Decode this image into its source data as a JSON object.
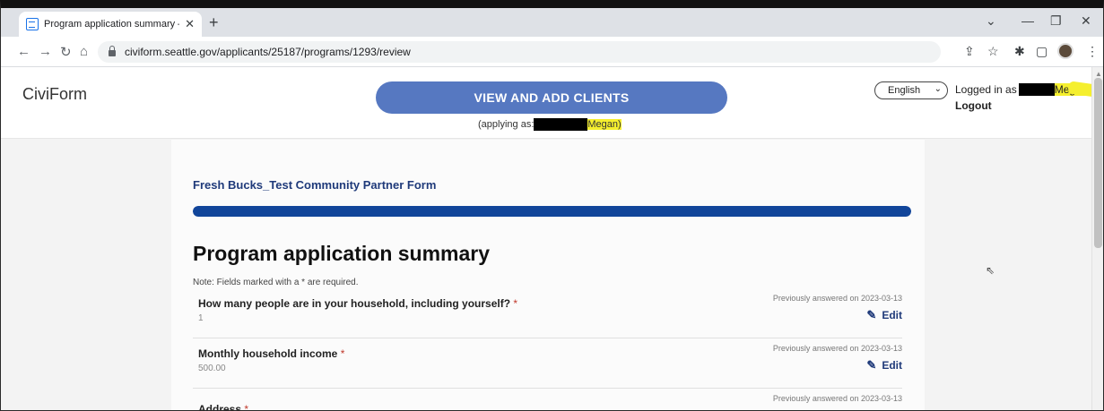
{
  "browser": {
    "tab_title": "Program application summary —",
    "tab_close": "✕",
    "new_tab": "+",
    "url": "civiform.seattle.gov/applicants/25187/programs/1293/review",
    "window_controls": {
      "minimize_menu": "⌄",
      "minimize": "—",
      "restore": "❐",
      "close": "✕"
    },
    "nav": {
      "back": "←",
      "forward": "→",
      "reload": "↻",
      "home": "⌂"
    },
    "toolbar_icons": {
      "share": "⇪",
      "star": "☆",
      "extensions": "✱",
      "sidepanel": "▢",
      "menu": "⋮"
    }
  },
  "header": {
    "brand": "CiviForm",
    "clients_button": "VIEW AND ADD CLIENTS",
    "applying_prefix": "(applying as:",
    "applying_suffix": "Megan)",
    "language": "English",
    "language_chevron": "⌄",
    "logged_in_prefix": "Logged in as",
    "logged_in_suffix": "Megan",
    "logout": "Logout"
  },
  "form": {
    "program_name": "Fresh Bucks_Test Community Partner Form",
    "progress": 1.0,
    "summary_title": "Program application summary",
    "note": "Note: Fields marked with a * are required.",
    "questions": [
      {
        "question": "How many people are in your household, including yourself?",
        "required_mark": "*",
        "answer": "1",
        "previous": "Previously answered on 2023-03-13",
        "edit": "Edit"
      },
      {
        "question": "Monthly household income",
        "required_mark": "*",
        "answer": "500.00",
        "previous": "Previously answered on 2023-03-13",
        "edit": "Edit"
      },
      {
        "question": "Address",
        "required_mark": "*",
        "answer": "",
        "previous": "Previously answered on 2023-03-13",
        "edit": ""
      }
    ]
  },
  "colors": {
    "accent": "#11459a",
    "button": "#5678c1",
    "highlight": "#f5ef2e",
    "required": "#c0392b"
  }
}
